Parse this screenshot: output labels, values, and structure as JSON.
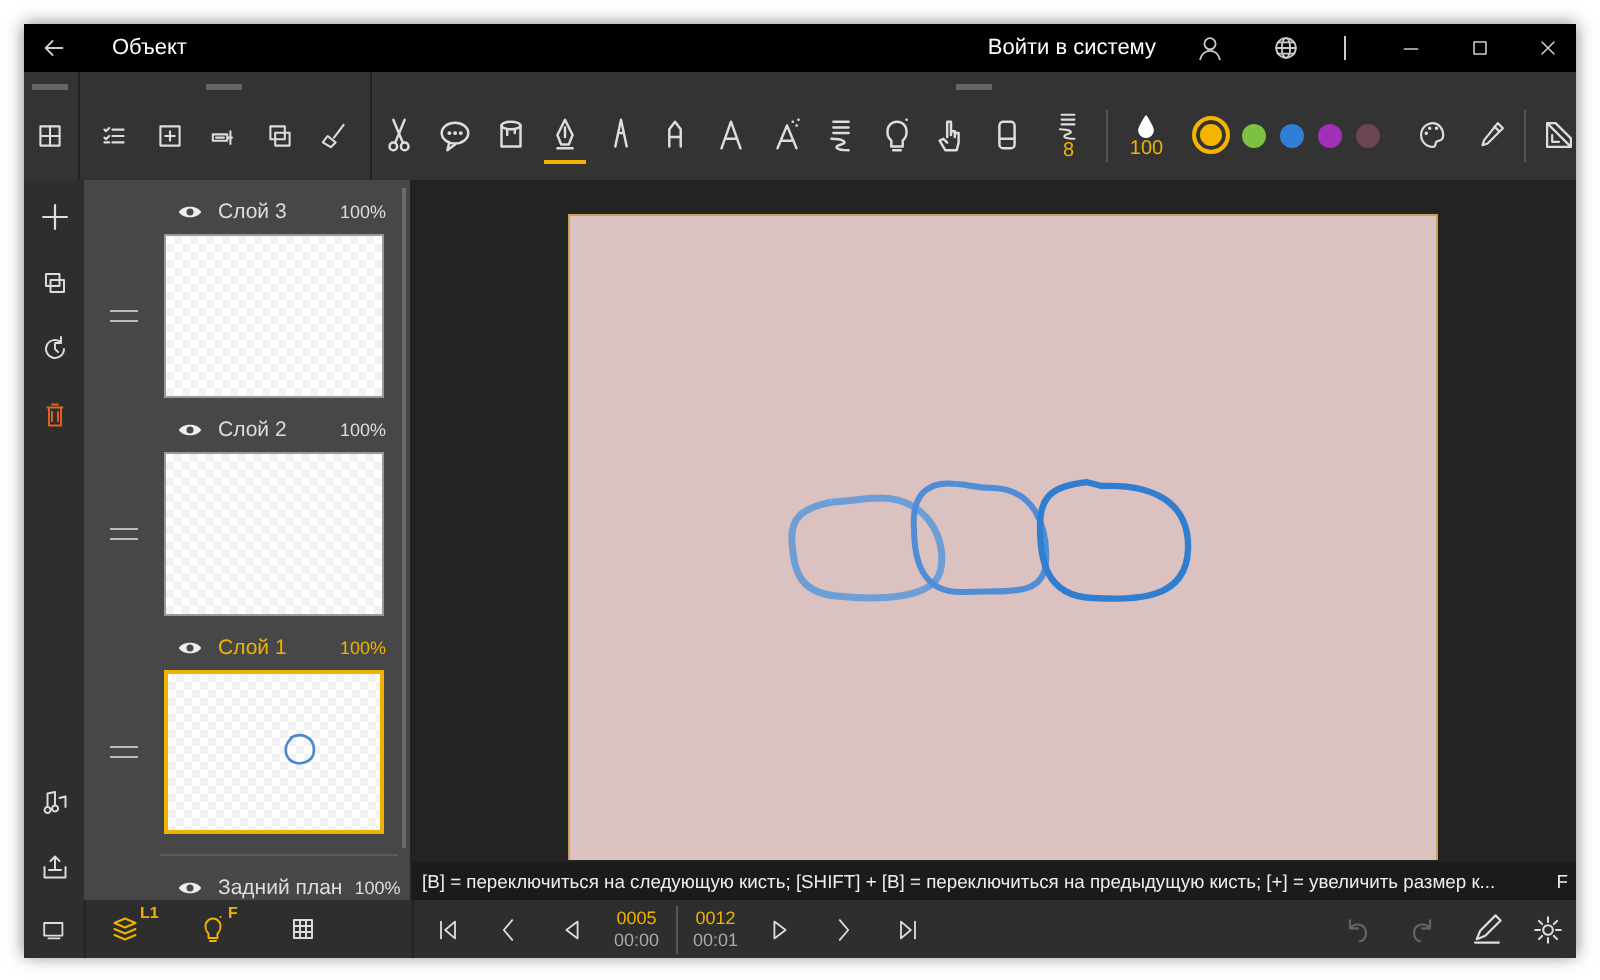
{
  "window": {
    "title": "Объект",
    "sign_in": "Войти в систему"
  },
  "toolbar": {
    "tools": [
      {
        "kind": "scissors",
        "selected": false
      },
      {
        "kind": "speech",
        "selected": false
      },
      {
        "kind": "bucket",
        "selected": false
      },
      {
        "kind": "pen",
        "selected": true
      },
      {
        "kind": "pencil",
        "selected": false
      },
      {
        "kind": "marker",
        "selected": false
      },
      {
        "kind": "tip",
        "selected": false
      },
      {
        "kind": "airbrush",
        "selected": false
      },
      {
        "kind": "ribbon",
        "selected": false
      },
      {
        "kind": "bulb",
        "selected": false
      },
      {
        "kind": "hand",
        "selected": false
      },
      {
        "kind": "eraser",
        "selected": false
      }
    ],
    "brush_size": "8",
    "opacity": "100",
    "colors": [
      {
        "color": "#f5b400",
        "selected": true
      },
      {
        "color": "#7cc142",
        "selected": false
      },
      {
        "color": "#2f7fd6",
        "selected": false
      },
      {
        "color": "#a22fb8",
        "selected": false
      },
      {
        "color": "#6c4650",
        "selected": false
      }
    ]
  },
  "layers": [
    {
      "kind": "blank",
      "name": "Слой 3",
      "opacity": "100%",
      "selected": false
    },
    {
      "kind": "blank",
      "name": "Слой 2",
      "opacity": "100%",
      "selected": false
    },
    {
      "kind": "doodle",
      "name": "Слой 1",
      "opacity": "100%",
      "selected": true
    },
    {
      "kind": "background",
      "name": "Задний план",
      "opacity": "100%",
      "selected": false
    }
  ],
  "canvas": {
    "status_hint": "[B] = переключиться на следующую кисть; [SHIFT] + [B] = переключиться на предыдущую кисть; [+] = увеличить размер к...",
    "status_extra": "F"
  },
  "bottom_bar": {
    "layers_badge": "L1",
    "light_badge": "F",
    "current_frame": "0005",
    "current_time": "00:00",
    "total_frames": "0012",
    "total_time": "00:01",
    "history": [
      {
        "kind": "undo",
        "disabled": true
      },
      {
        "kind": "redo",
        "disabled": true
      }
    ]
  }
}
